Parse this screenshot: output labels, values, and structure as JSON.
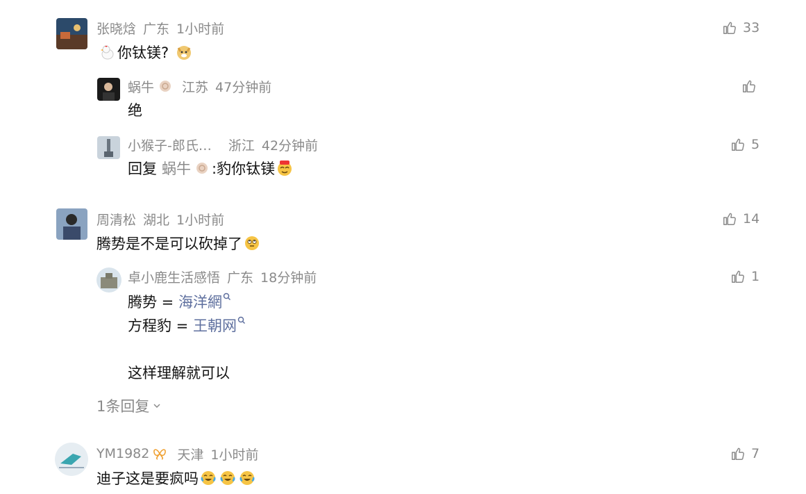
{
  "comments": [
    {
      "user": "张晓焓",
      "location": "广东",
      "time": "1小时前",
      "likes": "33",
      "text": "你钛镁?",
      "replies": [
        {
          "user": "蜗牛",
          "location": "江苏",
          "time": "47分钟前",
          "likes": "",
          "text": "绝"
        },
        {
          "user": "小猴子-郎氏…",
          "location": "浙江",
          "time": "42分钟前",
          "likes": "5",
          "reply_prefix": "回复",
          "mention": "蜗牛",
          "text": ":豹你钛镁"
        }
      ]
    },
    {
      "user": "周清松",
      "location": "湖北",
      "time": "1小时前",
      "likes": "14",
      "text": "腾势是不是可以砍掉了",
      "replies": [
        {
          "user": "卓小鹿生活感悟",
          "location": "广东",
          "time": "18分钟前",
          "likes": "1",
          "line1_prefix": "腾势 = ",
          "line1_link": "海洋網",
          "line2_prefix": "方程豹 = ",
          "line2_link": "王朝网",
          "line3": "这样理解就可以"
        }
      ],
      "more_replies": "1条回复"
    },
    {
      "user": "YM1982",
      "location": "天津",
      "time": "1小时前",
      "likes": "7",
      "text": "迪子这是要疯吗"
    }
  ]
}
